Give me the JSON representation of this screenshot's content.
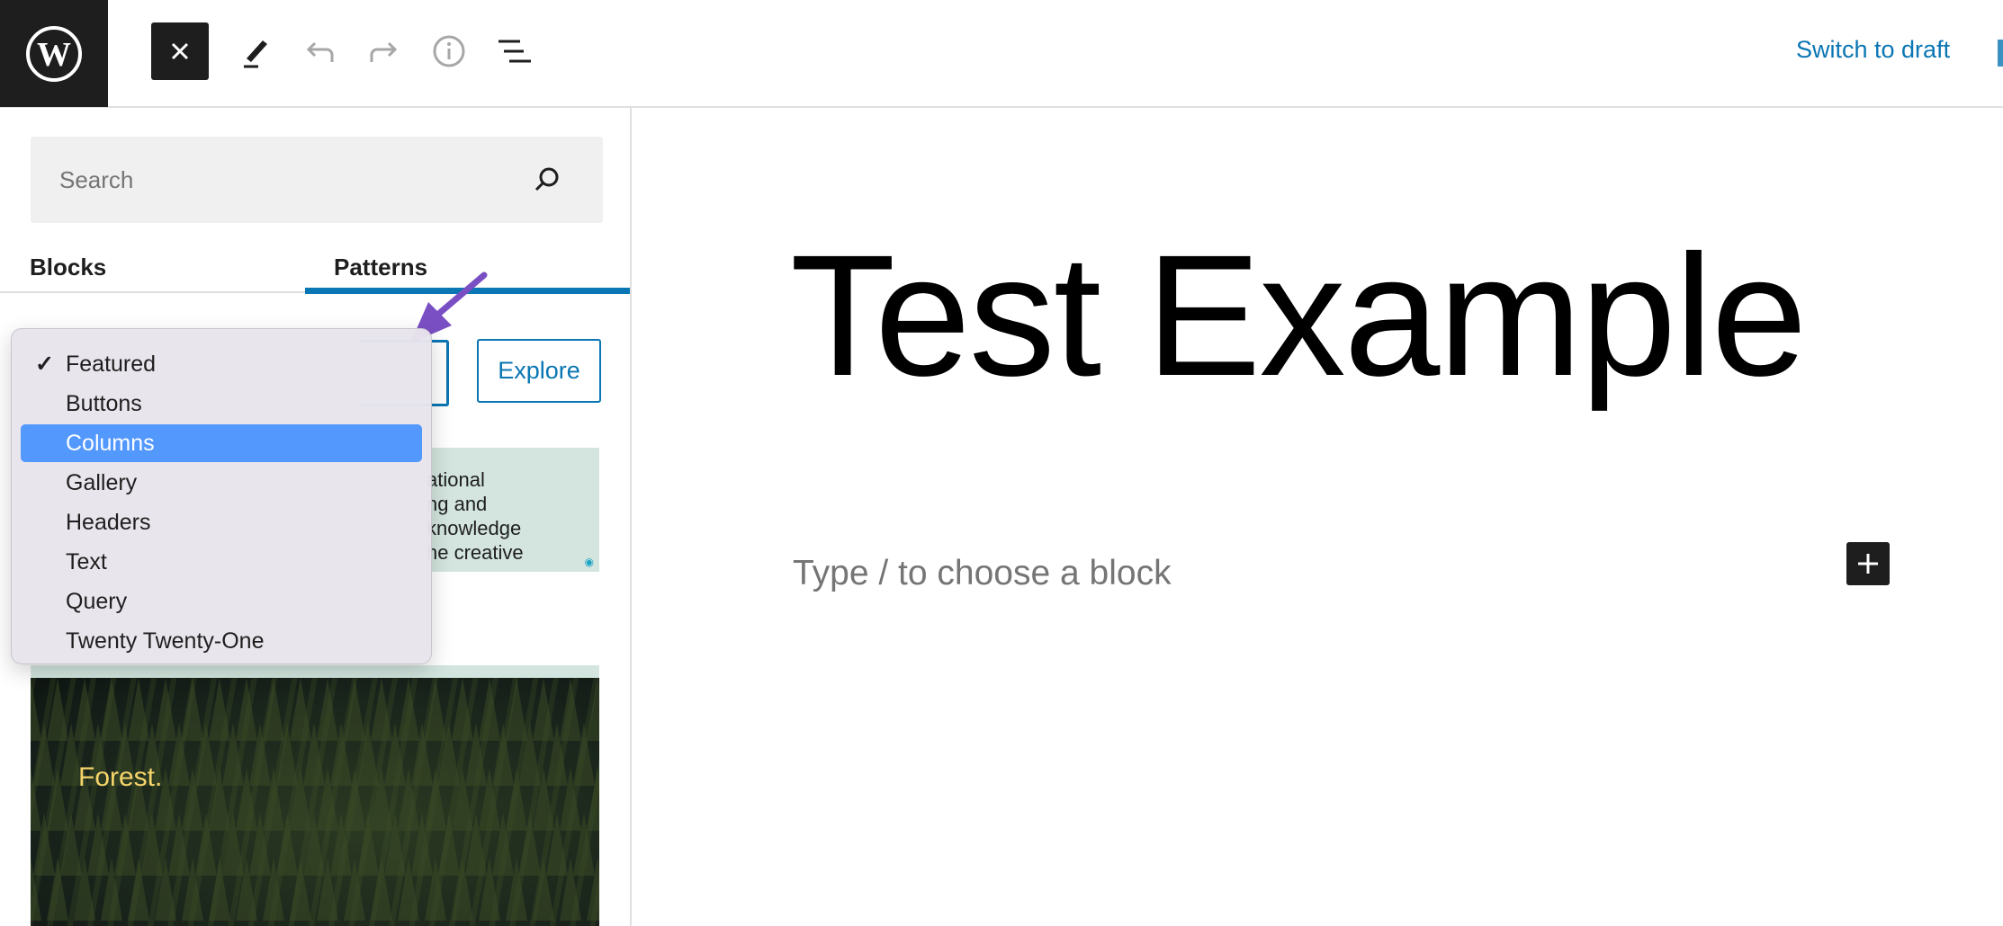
{
  "header": {
    "logo": "wordpress-logo",
    "close_label": "×",
    "switch_to_draft": "Switch to draft",
    "icons": [
      "close-icon",
      "pencil-icon",
      "undo-icon",
      "redo-icon",
      "info-icon",
      "list-view-icon"
    ]
  },
  "sidebar": {
    "search_placeholder": "Search",
    "tabs": [
      {
        "label": "Blocks",
        "active": false
      },
      {
        "label": "Patterns",
        "active": true
      }
    ],
    "explore_label": "Explore",
    "dropdown": {
      "options": [
        {
          "label": "Featured",
          "checked": true,
          "highlighted": false
        },
        {
          "label": "Buttons",
          "checked": false,
          "highlighted": false
        },
        {
          "label": "Columns",
          "checked": false,
          "highlighted": true
        },
        {
          "label": "Gallery",
          "checked": false,
          "highlighted": false
        },
        {
          "label": "Headers",
          "checked": false,
          "highlighted": false
        },
        {
          "label": "Text",
          "checked": false,
          "highlighted": false
        },
        {
          "label": "Query",
          "checked": false,
          "highlighted": false
        },
        {
          "label": "Twenty Twenty-One",
          "checked": false,
          "highlighted": false
        }
      ],
      "check_mark": "✓"
    },
    "preview1_lines": [
      "ational",
      "ng and",
      "knowledge",
      "he creative"
    ],
    "preview2_text": "Forest."
  },
  "editor": {
    "title": "Test Example",
    "block_placeholder": "Type / to choose a block",
    "add_block_label": "+"
  },
  "colors": {
    "accent": "#0a76b3",
    "highlight": "#5398fd",
    "annotation_arrow": "#7a4fc4"
  }
}
